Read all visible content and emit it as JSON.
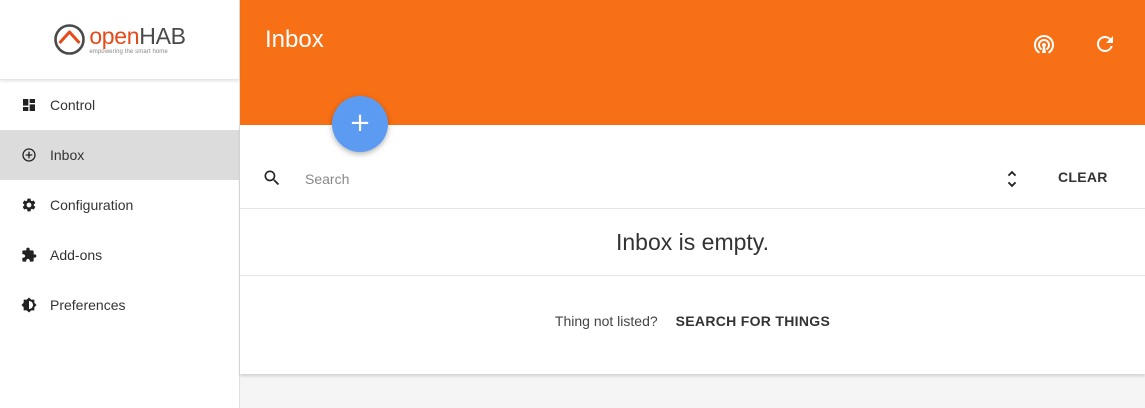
{
  "brand": {
    "name_part1": "open",
    "name_part2": "HAB",
    "tagline": "empowering the smart home",
    "accent": "#e64a19"
  },
  "sidebar": {
    "items": [
      {
        "label": "Control",
        "icon": "dashboard-icon"
      },
      {
        "label": "Inbox",
        "icon": "add-circle-icon",
        "active": true
      },
      {
        "label": "Configuration",
        "icon": "gear-icon"
      },
      {
        "label": "Add-ons",
        "icon": "puzzle-icon"
      },
      {
        "label": "Preferences",
        "icon": "brightness-icon"
      }
    ]
  },
  "header": {
    "title": "Inbox",
    "color": "#f87015",
    "actions": [
      {
        "icon": "wifi-tethering-icon"
      },
      {
        "icon": "refresh-icon"
      }
    ]
  },
  "fab": {
    "glyph": "+",
    "icon": "plus-icon",
    "color": "#5c9bf2"
  },
  "search": {
    "placeholder": "Search",
    "value": "",
    "sort_icon": "unfold-icon",
    "clear_label": "CLEAR"
  },
  "inbox": {
    "empty_message": "Inbox is empty.",
    "not_listed_label": "Thing not listed?",
    "search_things_label": "SEARCH FOR THINGS"
  }
}
